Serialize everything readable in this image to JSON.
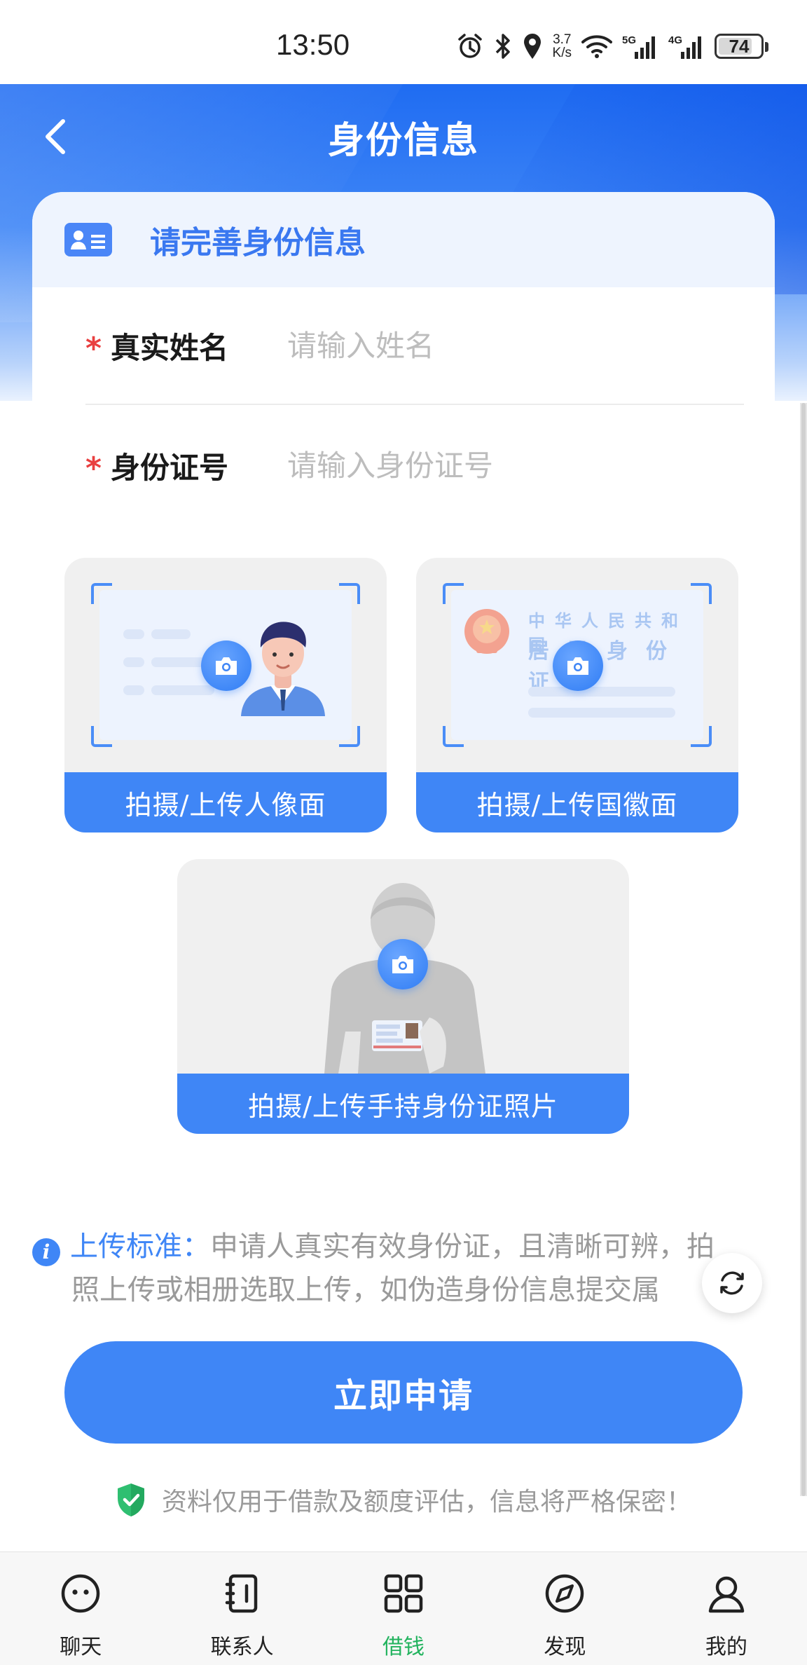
{
  "status_bar": {
    "time": "13:50",
    "net_speed_value": "3.7",
    "net_speed_unit": "K/s",
    "signal_1": "5G",
    "signal_2": "4G",
    "battery": "74"
  },
  "nav": {
    "title": "身份信息",
    "back_icon": "chevron-left-icon"
  },
  "form": {
    "header_title": "请完善身份信息",
    "required_mark": "*",
    "name_label": "真实姓名",
    "name_placeholder": "请输入姓名",
    "id_label": "身份证号",
    "id_placeholder": "请输入身份证号"
  },
  "uploads": {
    "front_label": "拍摄/上传人像面",
    "back_label": "拍摄/上传国徽面",
    "back_card_line1": "中华人民共和国",
    "back_card_line2": "居民身份证",
    "hold_label": "拍摄/上传手持身份证照片"
  },
  "notice": {
    "title": "上传标准：",
    "line1": "申请人真实有效身份证，且清晰可辨，拍",
    "line2": "照上传或相册选取上传，如伪造身份信息提交属"
  },
  "actions": {
    "apply_label": "立即申请"
  },
  "privacy": {
    "text": "资料仅用于借款及额度评估，信息将严格保密！"
  },
  "tabs": [
    {
      "label": "聊天",
      "icon": "chat-face-icon"
    },
    {
      "label": "联系人",
      "icon": "contacts-icon"
    },
    {
      "label": "借钱",
      "icon": "grid-apps-icon"
    },
    {
      "label": "发现",
      "icon": "compass-icon"
    },
    {
      "label": "我的",
      "icon": "person-icon"
    }
  ],
  "colors": {
    "brand_blue": "#3f86f6",
    "required_red": "#e94040",
    "tab_active_green": "#22b35e"
  }
}
